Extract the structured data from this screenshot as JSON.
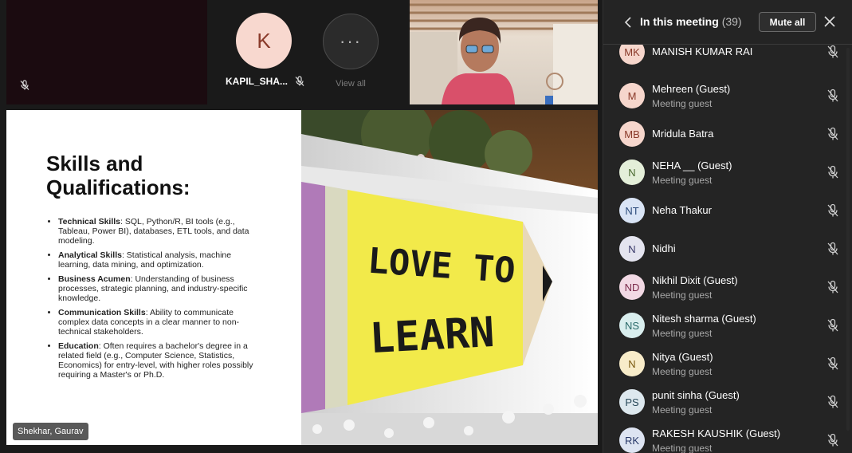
{
  "tiles": {
    "k_initial": "K",
    "k_name": "KAPIL_SHA...",
    "more_glyph": "···",
    "view_all": "View all"
  },
  "slide": {
    "title_line1": "Skills and",
    "title_line2": "Qualifications:",
    "bullets": [
      {
        "term": "Technical Skills",
        "text": ": SQL, Python/R, BI tools (e.g., Tableau, Power BI), databases, ETL tools, and data modeling."
      },
      {
        "term": "Analytical Skills",
        "text": ": Statistical analysis, machine learning, data mining, and optimization."
      },
      {
        "term": "Business Acumen",
        "text": ": Understanding of business processes, strategic planning, and industry-specific knowledge."
      },
      {
        "term": "Communication Skills",
        "text": ": Ability to communicate complex data concepts in a clear manner to non-technical stakeholders."
      },
      {
        "term": "Education",
        "text": ": Often requires a bachelor's degree in a related field (e.g., Computer Science, Statistics, Economics) for entry-level, with higher roles possibly requiring a Master's or Ph.D."
      }
    ],
    "photo_line1": "LOVE TO",
    "photo_line2": "LEARN",
    "presenter": "Shekhar, Gaurav"
  },
  "panel": {
    "title": "In this meeting",
    "count": "(39)",
    "mute_all": "Mute all",
    "participants": [
      {
        "initials": "MK",
        "name": "MANISH KUMAR RAI",
        "sub": "",
        "bg": "#f6d6cc",
        "fg": "#8a3a2a"
      },
      {
        "initials": "M",
        "name": "Mehreen (Guest)",
        "sub": "Meeting guest",
        "bg": "#f6d6cc",
        "fg": "#8a3a2a"
      },
      {
        "initials": "MB",
        "name": "Mridula Batra",
        "sub": "",
        "bg": "#f6d6cc",
        "fg": "#8a3a2a"
      },
      {
        "initials": "N",
        "name": "NEHA __ (Guest)",
        "sub": "Meeting guest",
        "bg": "#e4efd9",
        "fg": "#4a6a30"
      },
      {
        "initials": "NT",
        "name": "Neha Thakur",
        "sub": "",
        "bg": "#d9e4f5",
        "fg": "#2a4a7a"
      },
      {
        "initials": "N",
        "name": "Nidhi",
        "sub": "",
        "bg": "#e4e4ef",
        "fg": "#3a3a6a"
      },
      {
        "initials": "ND",
        "name": "Nikhil Dixit (Guest)",
        "sub": "Meeting guest",
        "bg": "#f2d9e4",
        "fg": "#7a2a4a"
      },
      {
        "initials": "NS",
        "name": "Nitesh sharma (Guest)",
        "sub": "Meeting guest",
        "bg": "#d9eeee",
        "fg": "#2a6a6a"
      },
      {
        "initials": "N",
        "name": "Nitya (Guest)",
        "sub": "Meeting guest",
        "bg": "#f8ecc9",
        "fg": "#7a5a10"
      },
      {
        "initials": "PS",
        "name": "punit sinha (Guest)",
        "sub": "Meeting guest",
        "bg": "#dde8ee",
        "fg": "#2a4a5a"
      },
      {
        "initials": "RK",
        "name": "RAKESH KAUSHIK (Guest)",
        "sub": "Meeting guest",
        "bg": "#dde4f2",
        "fg": "#2a3a6a"
      }
    ]
  }
}
